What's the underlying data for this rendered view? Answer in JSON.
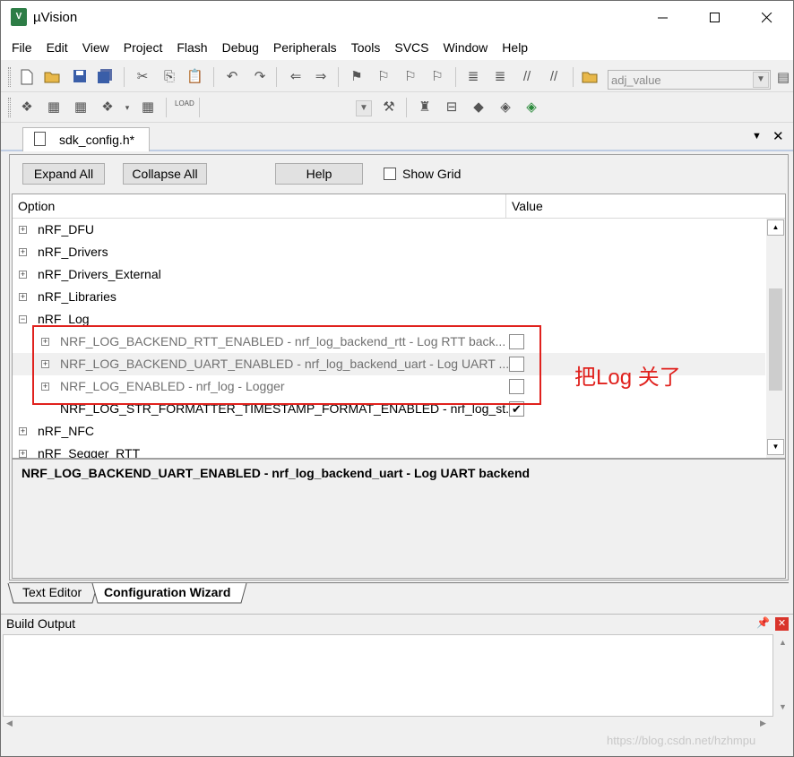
{
  "window": {
    "title": "µVision",
    "app_icon": "V"
  },
  "menu": [
    "File",
    "Edit",
    "View",
    "Project",
    "Flash",
    "Debug",
    "Peripherals",
    "Tools",
    "SVCS",
    "Window",
    "Help"
  ],
  "toolbar": {
    "find_combo_value": "adj_value"
  },
  "document_tab": {
    "label": "sdk_config.h*"
  },
  "wizard": {
    "expand_all": "Expand All",
    "collapse_all": "Collapse All",
    "help": "Help",
    "show_grid": "Show Grid",
    "col_option": "Option",
    "col_value": "Value",
    "rows": [
      {
        "label": "nRF_DFU",
        "expander": "+",
        "level": 0
      },
      {
        "label": "nRF_Drivers",
        "expander": "+",
        "level": 0
      },
      {
        "label": "nRF_Drivers_External",
        "expander": "+",
        "level": 0
      },
      {
        "label": "nRF_Libraries",
        "expander": "+",
        "level": 0
      },
      {
        "label": "nRF_Log",
        "expander": "−",
        "level": 0
      },
      {
        "label": "NRF_LOG_BACKEND_RTT_ENABLED - nrf_log_backend_rtt - Log RTT back...",
        "expander": "+",
        "level": 1,
        "checked": false,
        "disabled": true
      },
      {
        "label": "NRF_LOG_BACKEND_UART_ENABLED - nrf_log_backend_uart - Log UART ...",
        "expander": "+",
        "level": 1,
        "checked": false,
        "disabled": true,
        "selected": true
      },
      {
        "label": "NRF_LOG_ENABLED - nrf_log - Logger",
        "expander": "+",
        "level": 1,
        "checked": false,
        "disabled": true
      },
      {
        "label": "NRF_LOG_STR_FORMATTER_TIMESTAMP_FORMAT_ENABLED - nrf_log_st...",
        "expander": "",
        "level": 1,
        "checked": true,
        "disabled": false
      },
      {
        "label": "nRF_NFC",
        "expander": "+",
        "level": 0
      },
      {
        "label": "nRF_Segger_RTT",
        "expander": "+",
        "level": 0
      }
    ],
    "description": "NRF_LOG_BACKEND_UART_ENABLED - nrf_log_backend_uart - Log UART backend"
  },
  "annotation": "把Log 关了",
  "bottom_tabs": [
    "Text Editor",
    "Configuration Wizard"
  ],
  "build_output": {
    "title": "Build Output"
  },
  "watermark": "https://blog.csdn.net/hzhmpu",
  "colors": {
    "annotation_red": "#e0211d"
  }
}
